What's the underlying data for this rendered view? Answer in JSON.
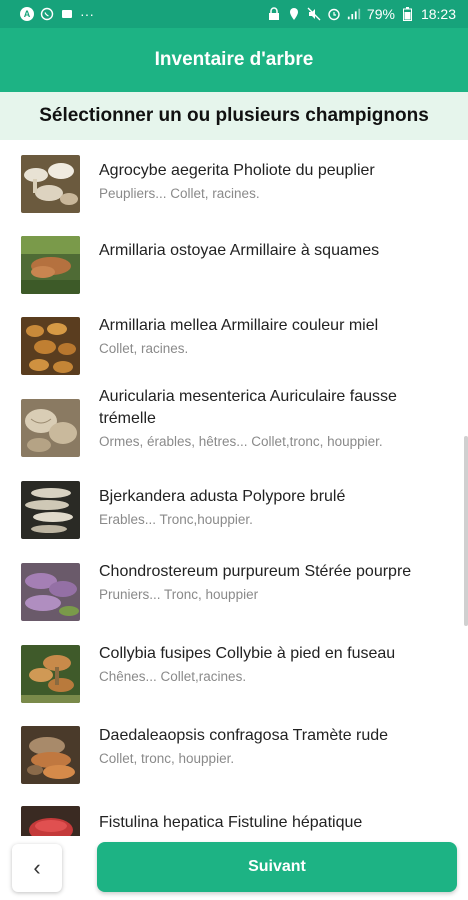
{
  "status_bar": {
    "left_icons": [
      "A",
      "whatsapp-icon",
      "sim-icon",
      "···"
    ],
    "battery": "79%",
    "time": "18:23"
  },
  "app_bar": {
    "title": "Inventaire d'arbre"
  },
  "subheader": {
    "text": "Sélectionner un ou plusieurs champignons"
  },
  "items": [
    {
      "title": "Agrocybe aegerita Pholiote du peuplier",
      "sub": "Peupliers... Collet, racines."
    },
    {
      "title": "Armillaria ostoyae  Armillaire à squames",
      "sub": ""
    },
    {
      "title": "Armillaria mellea  Armillaire couleur miel",
      "sub": "Collet, racines."
    },
    {
      "title": "Auricularia mesenterica  Auriculaire fausse trémelle",
      "sub": "Ormes, érables, hêtres... Collet,tronc, houppier."
    },
    {
      "title": "Bjerkandera adusta  Polypore brulé",
      "sub": "Erables... Tronc,houppier."
    },
    {
      "title": "Chondrostereum purpureum Stérée pourpre",
      "sub": "Pruniers... Tronc, houppier"
    },
    {
      "title": "Collybia fusipes  Collybie à pied en fuseau",
      "sub": "Chênes... Collet,racines."
    },
    {
      "title": "Daedaleaopsis confragosa   Tramète rude",
      "sub": "Collet, tronc, houppier."
    },
    {
      "title": "Fistulina hepatica  Fistuline hépatique",
      "sub": ""
    }
  ],
  "bottom": {
    "back_icon": "chevron-left-icon",
    "back_glyph": "‹",
    "next_label": "Suivant"
  },
  "colors": {
    "primary": "#1db384",
    "status": "#17a37b",
    "subheader_bg": "#e6f5ec"
  }
}
